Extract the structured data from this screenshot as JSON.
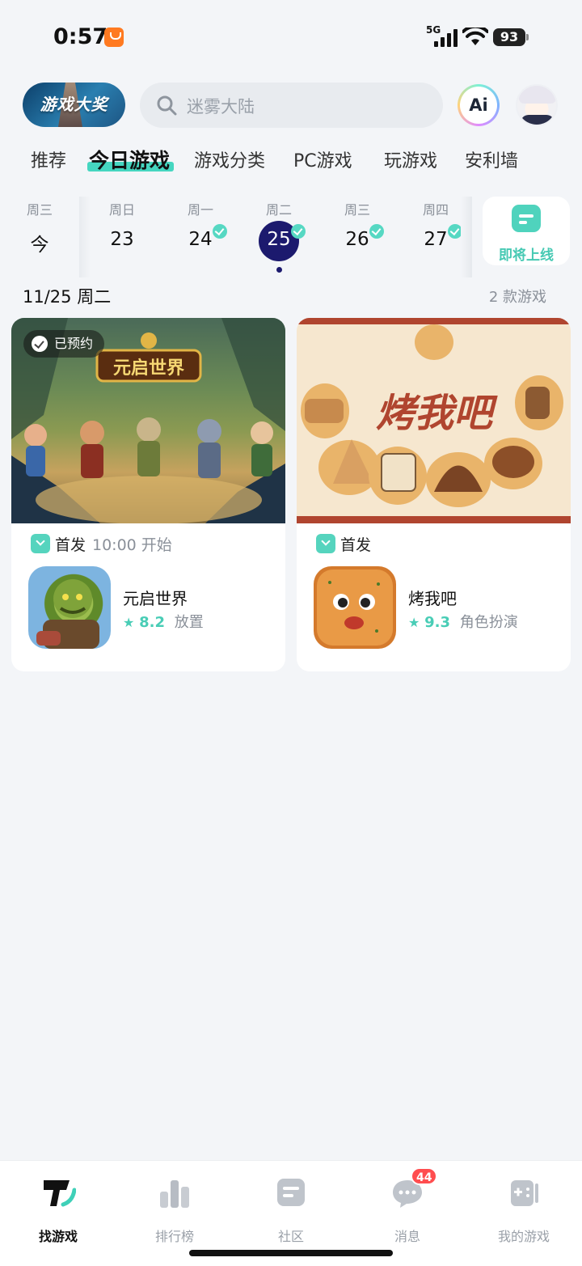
{
  "status_bar": {
    "time": "0:57",
    "network": "5G",
    "battery": "93"
  },
  "header": {
    "promo_label": "游戏大奖",
    "search_placeholder": "迷雾大陆",
    "ai_label": "Ai"
  },
  "tabs": [
    {
      "label": "推荐",
      "active": false
    },
    {
      "label": "今日游戏",
      "active": true
    },
    {
      "label": "游戏分类",
      "active": false
    },
    {
      "label": "PC游戏",
      "active": false
    },
    {
      "label": "玩游戏",
      "active": false
    },
    {
      "label": "安利墙",
      "active": false
    }
  ],
  "calendar": {
    "days": [
      {
        "weekday": "周三",
        "date": "今",
        "checked": false,
        "selected": false
      },
      {
        "weekday": "周日",
        "date": "23",
        "checked": false,
        "selected": false
      },
      {
        "weekday": "周一",
        "date": "24",
        "checked": true,
        "selected": false
      },
      {
        "weekday": "周二",
        "date": "25",
        "checked": true,
        "selected": true
      },
      {
        "weekday": "周三",
        "date": "26",
        "checked": true,
        "selected": false
      },
      {
        "weekday": "周四",
        "date": "27",
        "checked": true,
        "selected": false
      }
    ],
    "upcoming_label": "即将上线"
  },
  "day_heading": {
    "date": "11/25 周二",
    "count": "2 款游戏"
  },
  "games": [
    {
      "banner_title": "元启世界",
      "badge": "已预约",
      "release_label": "首发",
      "release_time": "10:00 开始",
      "name": "元启世界",
      "rating": "8.2",
      "genre": "放置"
    },
    {
      "banner_title": "烤我吧",
      "badge": "",
      "release_label": "首发",
      "release_time": "",
      "name": "烤我吧",
      "rating": "9.3",
      "genre": "角色扮演"
    }
  ],
  "bottom_nav": [
    {
      "label": "找游戏",
      "icon": "find-games-icon",
      "active": true,
      "badge": ""
    },
    {
      "label": "排行榜",
      "icon": "ranking-icon",
      "active": false,
      "badge": ""
    },
    {
      "label": "社区",
      "icon": "community-icon",
      "active": false,
      "badge": ""
    },
    {
      "label": "消息",
      "icon": "message-icon",
      "active": false,
      "badge": "44"
    },
    {
      "label": "我的游戏",
      "icon": "my-games-icon",
      "active": false,
      "badge": ""
    }
  ],
  "colors": {
    "accent": "#45d6c0",
    "selected_date": "#1c1a6e",
    "badge_red": "#ff4d4f"
  }
}
